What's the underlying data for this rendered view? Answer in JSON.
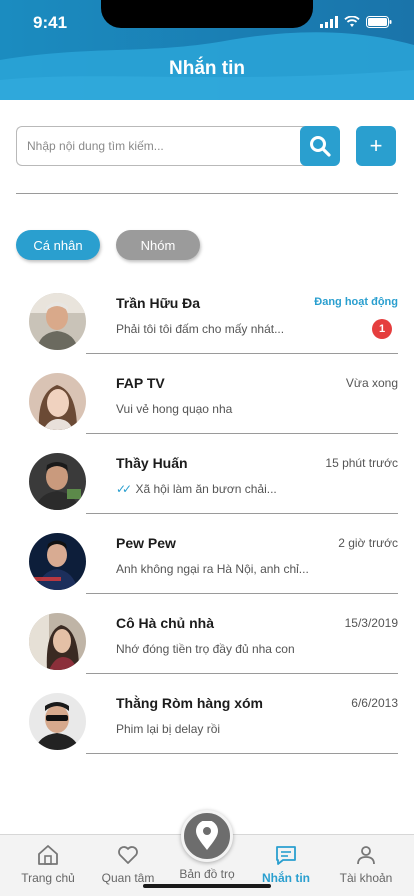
{
  "status_bar": {
    "time": "9:41"
  },
  "header": {
    "title": "Nhắn tin"
  },
  "search": {
    "placeholder": "Nhập nội dung tìm kiếm...",
    "search_icon": "search-icon",
    "add_label": "+"
  },
  "tabs": [
    {
      "label": "Cá nhân",
      "active": true
    },
    {
      "label": "Nhóm",
      "active": false
    }
  ],
  "conversations": [
    {
      "name": "Trần Hữu Đa",
      "time": "Đang hoạt động",
      "message": "Phải tôi tôi đấm cho mấy nhát...",
      "unread": "1"
    },
    {
      "name": "FAP TV",
      "time": "Vừa xong",
      "message": "Vui vẻ hong quạo nha"
    },
    {
      "name": "Thầy Huấn",
      "time": "15 phút trước",
      "message": "Xã hội làm ăn bươn chải...",
      "seen": true
    },
    {
      "name": "Pew Pew",
      "time": "2 giờ trước",
      "message": "Anh không ngại ra Hà Nội, anh chỉ..."
    },
    {
      "name": "Cô Hà chủ nhà",
      "time": "15/3/2019",
      "message": "Nhớ đóng tiền trọ đầy đủ nha con"
    },
    {
      "name": "Thằng Ròm hàng xóm",
      "time": "6/6/2013",
      "message": "Phim lại bị delay rồi"
    }
  ],
  "bottom_nav": [
    {
      "label": "Trang chủ",
      "icon": "home-icon"
    },
    {
      "label": "Quan tâm",
      "icon": "heart-icon"
    },
    {
      "label": "Bản đồ trọ",
      "icon": "map-pin-icon"
    },
    {
      "label": "Nhắn tin",
      "icon": "chat-icon",
      "active": true
    },
    {
      "label": "Tài khoản",
      "icon": "user-icon"
    }
  ],
  "colors": {
    "accent": "#2a9fcf",
    "header_dark": "#1b7fb3",
    "unread": "#e53e3e"
  }
}
